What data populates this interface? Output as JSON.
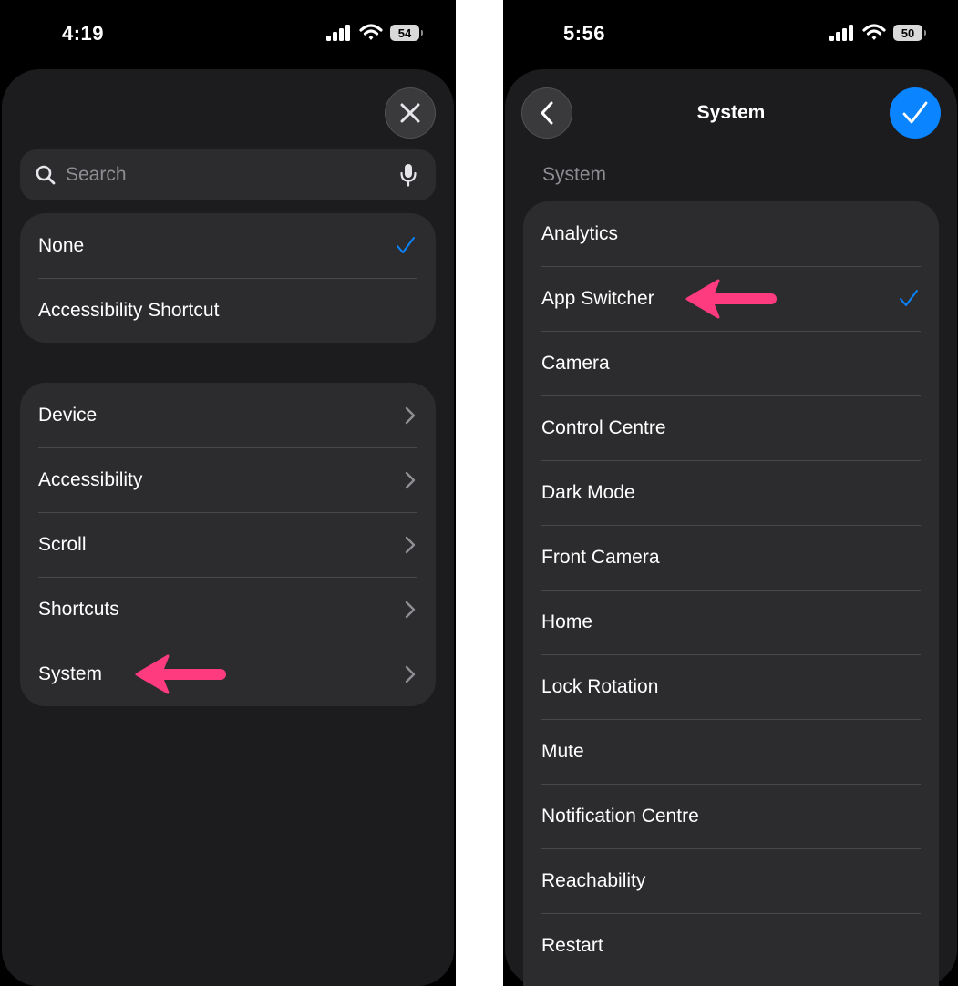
{
  "left_screen": {
    "status": {
      "time": "4:19",
      "battery": "54"
    },
    "search": {
      "placeholder": "Search"
    },
    "quick_list": [
      {
        "label": "None",
        "selected": true
      },
      {
        "label": "Accessibility Shortcut",
        "selected": false
      }
    ],
    "categories": [
      {
        "label": "Device"
      },
      {
        "label": "Accessibility"
      },
      {
        "label": "Scroll"
      },
      {
        "label": "Shortcuts"
      },
      {
        "label": "System"
      }
    ],
    "icons": {
      "close": "close-icon",
      "search": "search-icon",
      "mic": "microphone-icon",
      "chevron": "chevron-right-icon",
      "check": "checkmark-icon"
    }
  },
  "right_screen": {
    "status": {
      "time": "5:56",
      "battery": "50"
    },
    "nav": {
      "title": "System"
    },
    "section_header": "System",
    "items": [
      {
        "label": "Analytics",
        "selected": false
      },
      {
        "label": "App Switcher",
        "selected": true
      },
      {
        "label": "Camera",
        "selected": false
      },
      {
        "label": "Control Centre",
        "selected": false
      },
      {
        "label": "Dark Mode",
        "selected": false
      },
      {
        "label": "Front Camera",
        "selected": false
      },
      {
        "label": "Home",
        "selected": false
      },
      {
        "label": "Lock Rotation",
        "selected": false
      },
      {
        "label": "Mute",
        "selected": false
      },
      {
        "label": "Notification Centre",
        "selected": false
      },
      {
        "label": "Reachability",
        "selected": false
      },
      {
        "label": "Restart",
        "selected": false
      }
    ],
    "icons": {
      "back": "chevron-left-icon",
      "confirm": "checkmark-icon"
    }
  },
  "colors": {
    "background": "#000000",
    "sheet": "#1c1c1e",
    "cell": "#2c2c2e",
    "accent": "#0a84ff",
    "annotation_arrow": "#ff3b7f"
  }
}
